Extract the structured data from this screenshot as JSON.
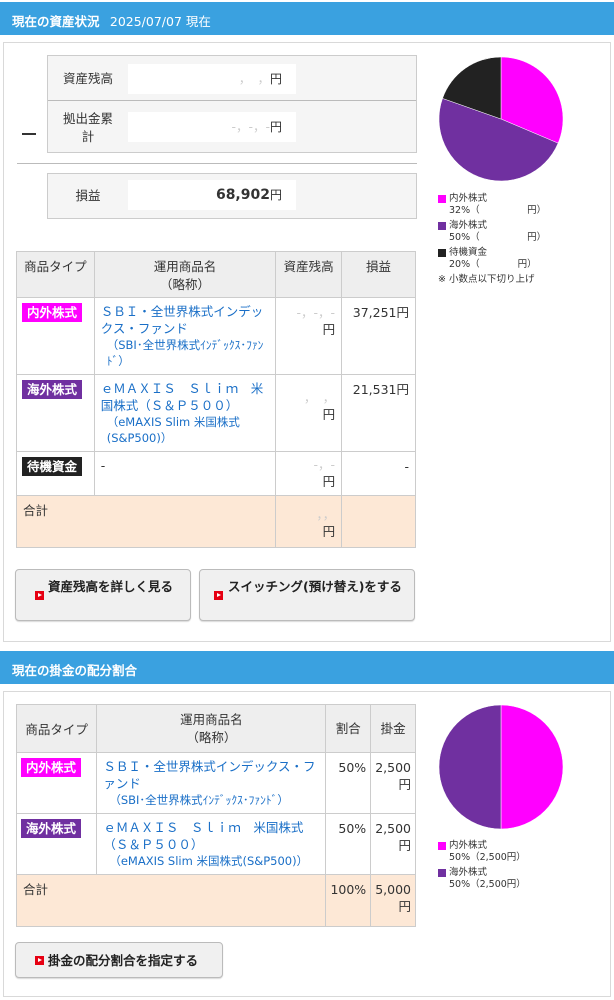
{
  "colors": {
    "domestic_foreign": "#ff00ff",
    "overseas": "#7030a0",
    "standby": "#222222",
    "header": "#3aa1e0"
  },
  "assets": {
    "header_title": "現在の資産状況",
    "header_date": "2025/07/07 現在",
    "balance_label": "資産残高",
    "balance_value": "，　，",
    "balance_unit": "円",
    "contrib_label_1": "拠出金累",
    "contrib_label_2": "計",
    "contrib_value": "-，-，-",
    "contrib_unit": "円",
    "pl_label": "損益",
    "pl_value": "68,902",
    "pl_unit": "円",
    "table": {
      "headers": [
        "商品タイプ",
        "運用商品名",
        "（略称）",
        "資産残高",
        "損益"
      ],
      "rows": [
        {
          "badge": "内外株式",
          "fund": "ＳＢＩ・全世界株式インデックス・ファンド",
          "fund_sub": "（SBI･全世界株式ｲﾝﾃﾞｯｸｽ･ﾌｧﾝﾄﾞ）",
          "balance": "-，-，-",
          "balance_unit": "円",
          "pl": "37,251円"
        },
        {
          "badge": "海外株式",
          "fund": "ｅＭＡＸＩＳ　Ｓｌｉｍ　米国株式（Ｓ＆Ｐ５００）",
          "fund_sub": "（eMAXIS Slim 米国株式(S&P500)）",
          "balance": "，　，",
          "balance_unit": "円",
          "pl": "21,531円"
        },
        {
          "badge": "待機資金",
          "fund": "-",
          "fund_sub": "",
          "balance": "-，-",
          "balance_unit": "円",
          "pl": "-"
        }
      ],
      "total_label": "合計",
      "total_balance": "，，",
      "total_unit": "円"
    },
    "btn_detail": "資産残高を詳しく見る",
    "btn_switch": "スイッチング(預け替え)をする",
    "legend": [
      {
        "name": "内外株式",
        "pct": "32%（",
        "amount_tail": "円）"
      },
      {
        "name": "海外株式",
        "pct": "50%（",
        "amount_tail": "円）"
      },
      {
        "name": "待機資金",
        "pct": "20%（",
        "amount_tail": "円）"
      }
    ],
    "legend_note": "※ 小数点以下切り上げ",
    "chart_data": {
      "type": "pie",
      "categories": [
        "内外株式",
        "海外株式",
        "待機資金"
      ],
      "values": [
        32,
        50,
        20
      ]
    }
  },
  "allocation": {
    "header_title": "現在の掛金の配分割合",
    "table": {
      "headers": [
        "商品タイプ",
        "運用商品名",
        "（略称）",
        "割合",
        "掛金"
      ],
      "rows": [
        {
          "badge": "内外株式",
          "fund": "ＳＢＩ・全世界株式インデックス・ファンド",
          "fund_sub": "（SBI･全世界株式ｲﾝﾃﾞｯｸｽ･ﾌｧﾝﾄﾞ）",
          "ratio": "50%",
          "amount": "2,500",
          "unit": "円"
        },
        {
          "badge": "海外株式",
          "fund": "ｅＭＡＸＩＳ　Ｓｌｉｍ　米国株式（Ｓ＆Ｐ５００）",
          "fund_sub": "（eMAXIS Slim 米国株式(S&P500)）",
          "ratio": "50%",
          "amount": "2,500",
          "unit": "円"
        }
      ],
      "total_label": "合計",
      "total_ratio": "100%",
      "total_amount": "5,000",
      "total_unit": "円"
    },
    "btn_set": "掛金の配分割合を指定する",
    "legend": [
      {
        "name": "内外株式",
        "detail": "50%（2,500円）"
      },
      {
        "name": "海外株式",
        "detail": "50%（2,500円）"
      }
    ],
    "chart_data": {
      "type": "pie",
      "categories": [
        "内外株式",
        "海外株式"
      ],
      "values": [
        50,
        50
      ]
    }
  }
}
